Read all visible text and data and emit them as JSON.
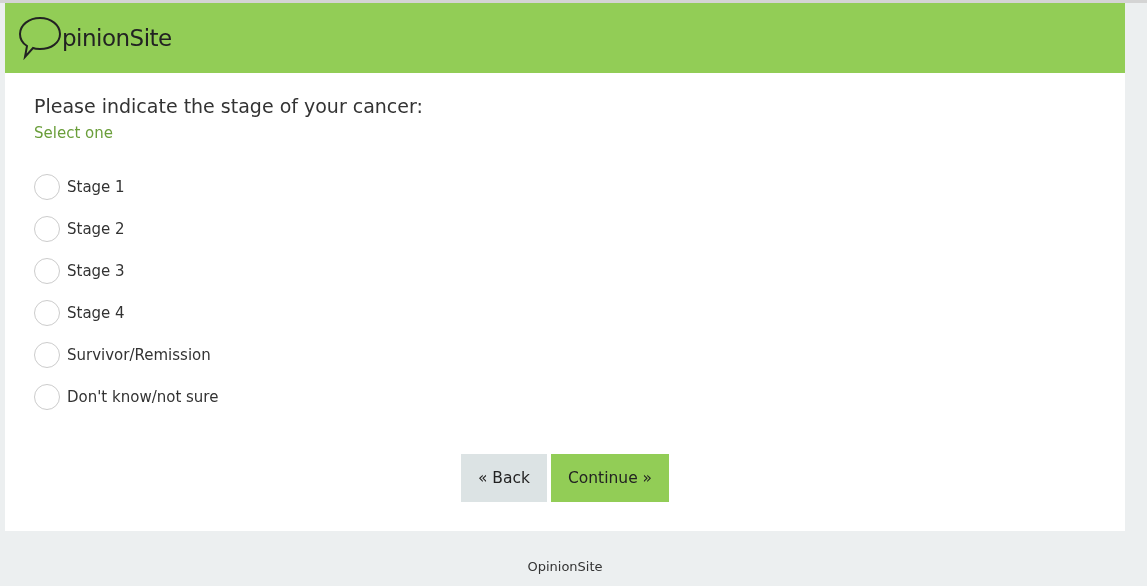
{
  "header": {
    "logo_text": "pinionSite"
  },
  "question": {
    "title": "Please indicate the stage of your cancer:",
    "instruction": "Select one"
  },
  "options": [
    {
      "label": "Stage 1",
      "selected": false
    },
    {
      "label": "Stage 2",
      "selected": false
    },
    {
      "label": "Stage 3",
      "selected": false
    },
    {
      "label": "Stage 4",
      "selected": false
    },
    {
      "label": "Survivor/Remission",
      "selected": false
    },
    {
      "label": "Don't know/not sure",
      "selected": false
    }
  ],
  "buttons": [
    {
      "label": "« Back",
      "kind": "back"
    },
    {
      "label": "Continue »",
      "kind": "continue"
    }
  ],
  "footer": "OpinionSite"
}
